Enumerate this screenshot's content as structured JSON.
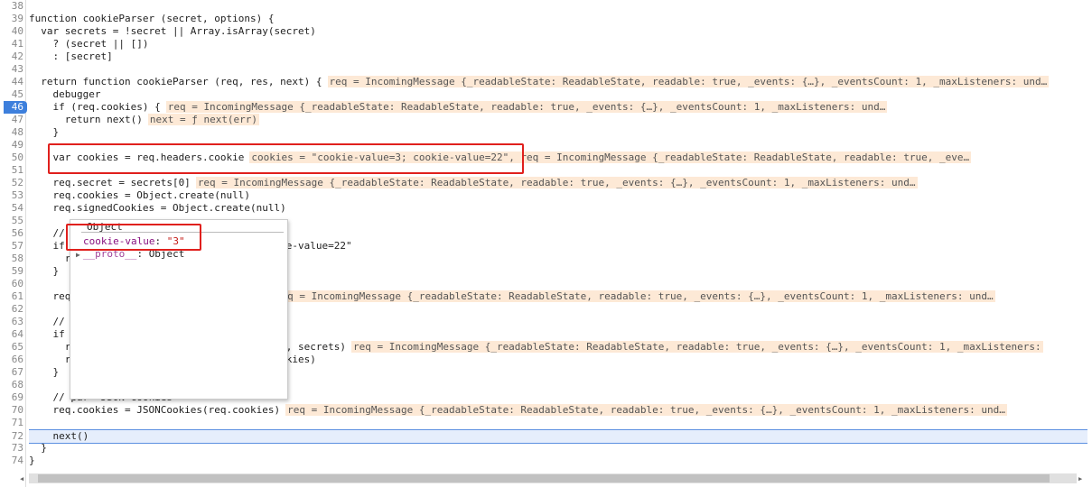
{
  "lines": [
    {
      "n": "38",
      "code": ""
    },
    {
      "n": "39",
      "code": "function cookieParser (secret, options) {"
    },
    {
      "n": "40",
      "code": "  var secrets = !secret || Array.isArray(secret)"
    },
    {
      "n": "41",
      "code": "    ? (secret || [])"
    },
    {
      "n": "42",
      "code": "    : [secret]"
    },
    {
      "n": "43",
      "code": ""
    },
    {
      "n": "44",
      "code": "  return function cookieParser (req, res, next) {",
      "inline": "req = IncomingMessage {_readableState: ReadableState, readable: true, _events: {…}, _eventsCount: 1, _maxListeners: und…"
    },
    {
      "n": "45",
      "code": "    debugger"
    },
    {
      "n": "46",
      "code": "    if (req.cookies) {",
      "inline": "req = IncomingMessage {_readableState: ReadableState, readable: true, _events: {…}, _eventsCount: 1, _maxListeners: und…"
    },
    {
      "n": "47",
      "code": "      return next()",
      "inline": "next = ƒ next(err)"
    },
    {
      "n": "48",
      "code": "    }"
    },
    {
      "n": "49",
      "code": ""
    },
    {
      "n": "50",
      "code": "    var cookies = req.headers.cookie",
      "inline": "cookies = \"cookie-value=3; cookie-value=22\", req = IncomingMessage {_readableState: ReadableState, readable: true, _eve…"
    },
    {
      "n": "51",
      "code": ""
    },
    {
      "n": "52",
      "code": "    req.secret = secrets[0]",
      "inline": "req = IncomingMessage {_readableState: ReadableState, readable: true, _events: {…}, _eventsCount: 1, _maxListeners: und…"
    },
    {
      "n": "53",
      "code": "    req.cookies = Object.create(null)"
    },
    {
      "n": "54",
      "code": "    req.signedCookies = Object.create(null)"
    },
    {
      "n": "55",
      "code": ""
    },
    {
      "n": "56",
      "code": "    //"
    },
    {
      "n": "57",
      "code": "    if                           e=3; cookie-value=22\""
    },
    {
      "n": "58",
      "code": "      r"
    },
    {
      "n": "59",
      "code": "    }"
    },
    {
      "n": "60",
      "code": ""
    },
    {
      "n": "61",
      "code": "    req                            ions)",
      "inline": "req = IncomingMessage {_readableState: ReadableState, readable: true, _events: {…}, _eventsCount: 1, _maxListeners: und…"
    },
    {
      "n": "62",
      "code": ""
    },
    {
      "n": "63",
      "code": "    //"
    },
    {
      "n": "64",
      "code": "    if"
    },
    {
      "n": "65",
      "code": "      r                            .cookies, secrets)",
      "inline": "req = IncomingMessage {_readableState: ReadableState, readable: true, _events: {…}, _eventsCount: 1, _maxListeners:"
    },
    {
      "n": "66",
      "code": "      r                            ignedCookies)"
    },
    {
      "n": "67",
      "code": "    }"
    },
    {
      "n": "68",
      "code": ""
    },
    {
      "n": "69",
      "code": "    // par  JSON cookies"
    },
    {
      "n": "70",
      "code": "    req.cookies = JSONCookies(req.cookies)",
      "inline": "req = IncomingMessage {_readableState: ReadableState, readable: true, _events: {…}, _eventsCount: 1, _maxListeners: und…"
    },
    {
      "n": "71",
      "code": ""
    },
    {
      "n": "72",
      "code": "    next()"
    },
    {
      "n": "73",
      "code": "  }"
    },
    {
      "n": "74",
      "code": "}"
    }
  ],
  "breakpoint_line": "46",
  "current_line": "72",
  "popup": {
    "title": "Object",
    "prop_key": "cookie-value",
    "prop_value": "\"3\"",
    "proto_label": "__proto__",
    "proto_value": "Object"
  },
  "colors": {
    "highlight_box": "#e0201d",
    "inline_bg": "#fde9d6",
    "exec_line": "#e6eefc",
    "breakpoint": "#3d7fdc"
  }
}
